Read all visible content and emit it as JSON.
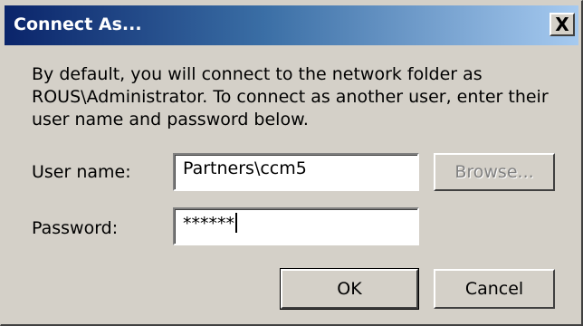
{
  "window": {
    "title": "Connect As...",
    "close_glyph": "X"
  },
  "description": "By default, you will connect to the network folder as ROUS\\Administrator. To connect as another user, enter their user name and password below.",
  "form": {
    "username_label": "User name:",
    "username_value": "Partners\\ccm5",
    "password_label": "Password:",
    "password_value": "******"
  },
  "buttons": {
    "browse": "Browse...",
    "ok": "OK",
    "cancel": "Cancel"
  }
}
